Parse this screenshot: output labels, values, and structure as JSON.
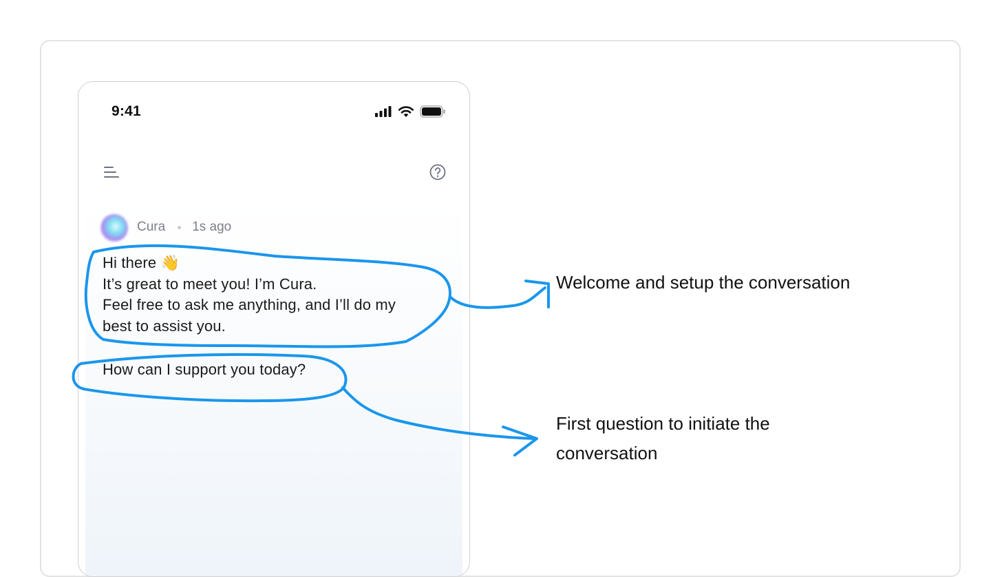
{
  "phone": {
    "status_time": "9:41",
    "sender_name": "Cura",
    "message_time": "1s ago",
    "greeting_lines": [
      "Hi there 👋",
      "It’s great to meet you! I’m Cura.",
      "Feel free to ask me anything, and I’ll do my",
      "best to assist you."
    ],
    "question": "How can I support you today?"
  },
  "annotations": {
    "welcome": "Welcome and setup the conversation",
    "first_question": "First question to initiate the conversation"
  },
  "icons": {
    "menu": "menu-icon",
    "help": "help-circle-icon",
    "signal": "cellular-signal-icon",
    "wifi": "wifi-icon",
    "battery": "battery-icon"
  },
  "colors": {
    "ink": "#1a96ec",
    "muted_text": "#7b808a",
    "card_border": "#e3e3e3"
  }
}
